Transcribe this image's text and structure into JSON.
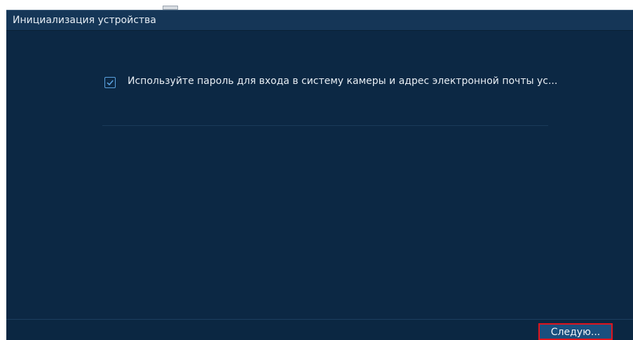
{
  "dialog": {
    "title": "Инициализация устройства",
    "consent_checkbox": {
      "checked": true,
      "label": "Используйте пароль для входа в систему камеры и адрес электронной почты ус..."
    },
    "next_button_label": "Следую..."
  },
  "colors": {
    "dialog_background": "#0c2844",
    "titlebar": "#153657",
    "checkbox_accent": "#5ba3e0",
    "highlight_border": "#e0141c"
  },
  "icons": {
    "checkbox": "check-icon"
  }
}
